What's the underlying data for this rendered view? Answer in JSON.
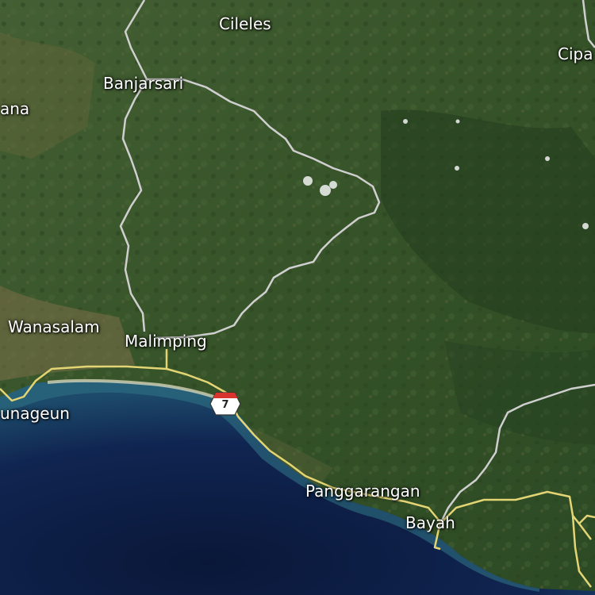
{
  "map": {
    "view": "satellite",
    "colors": {
      "land": "#3d5a32",
      "forest": "#2c4a25",
      "farmland": "#7a7048",
      "sea_deep": "#0d1a3e",
      "sea_shallow": "#2f6f84",
      "beach": "#c9c7a8",
      "admin_border": "#c8c8c8",
      "road": "#e6d77a",
      "shield_red": "#d9332e"
    },
    "places": [
      {
        "id": "cileles",
        "label": "Cileles"
      },
      {
        "id": "banjarsari",
        "label": "Banjarsari"
      },
      {
        "id": "rangkasbitung_fragment",
        "label": "ana"
      },
      {
        "id": "cipanas_fragment",
        "label": "Cipa"
      },
      {
        "id": "wanasalam",
        "label": "Wanasalam"
      },
      {
        "id": "malimping",
        "label": "Malimping"
      },
      {
        "id": "binuangeun",
        "label": "unageun"
      },
      {
        "id": "panggarangan",
        "label": "Panggarangan"
      },
      {
        "id": "bayah",
        "label": "Bayah"
      }
    ],
    "route_shield": {
      "number": "7",
      "icon": "route-shield-icon"
    }
  }
}
